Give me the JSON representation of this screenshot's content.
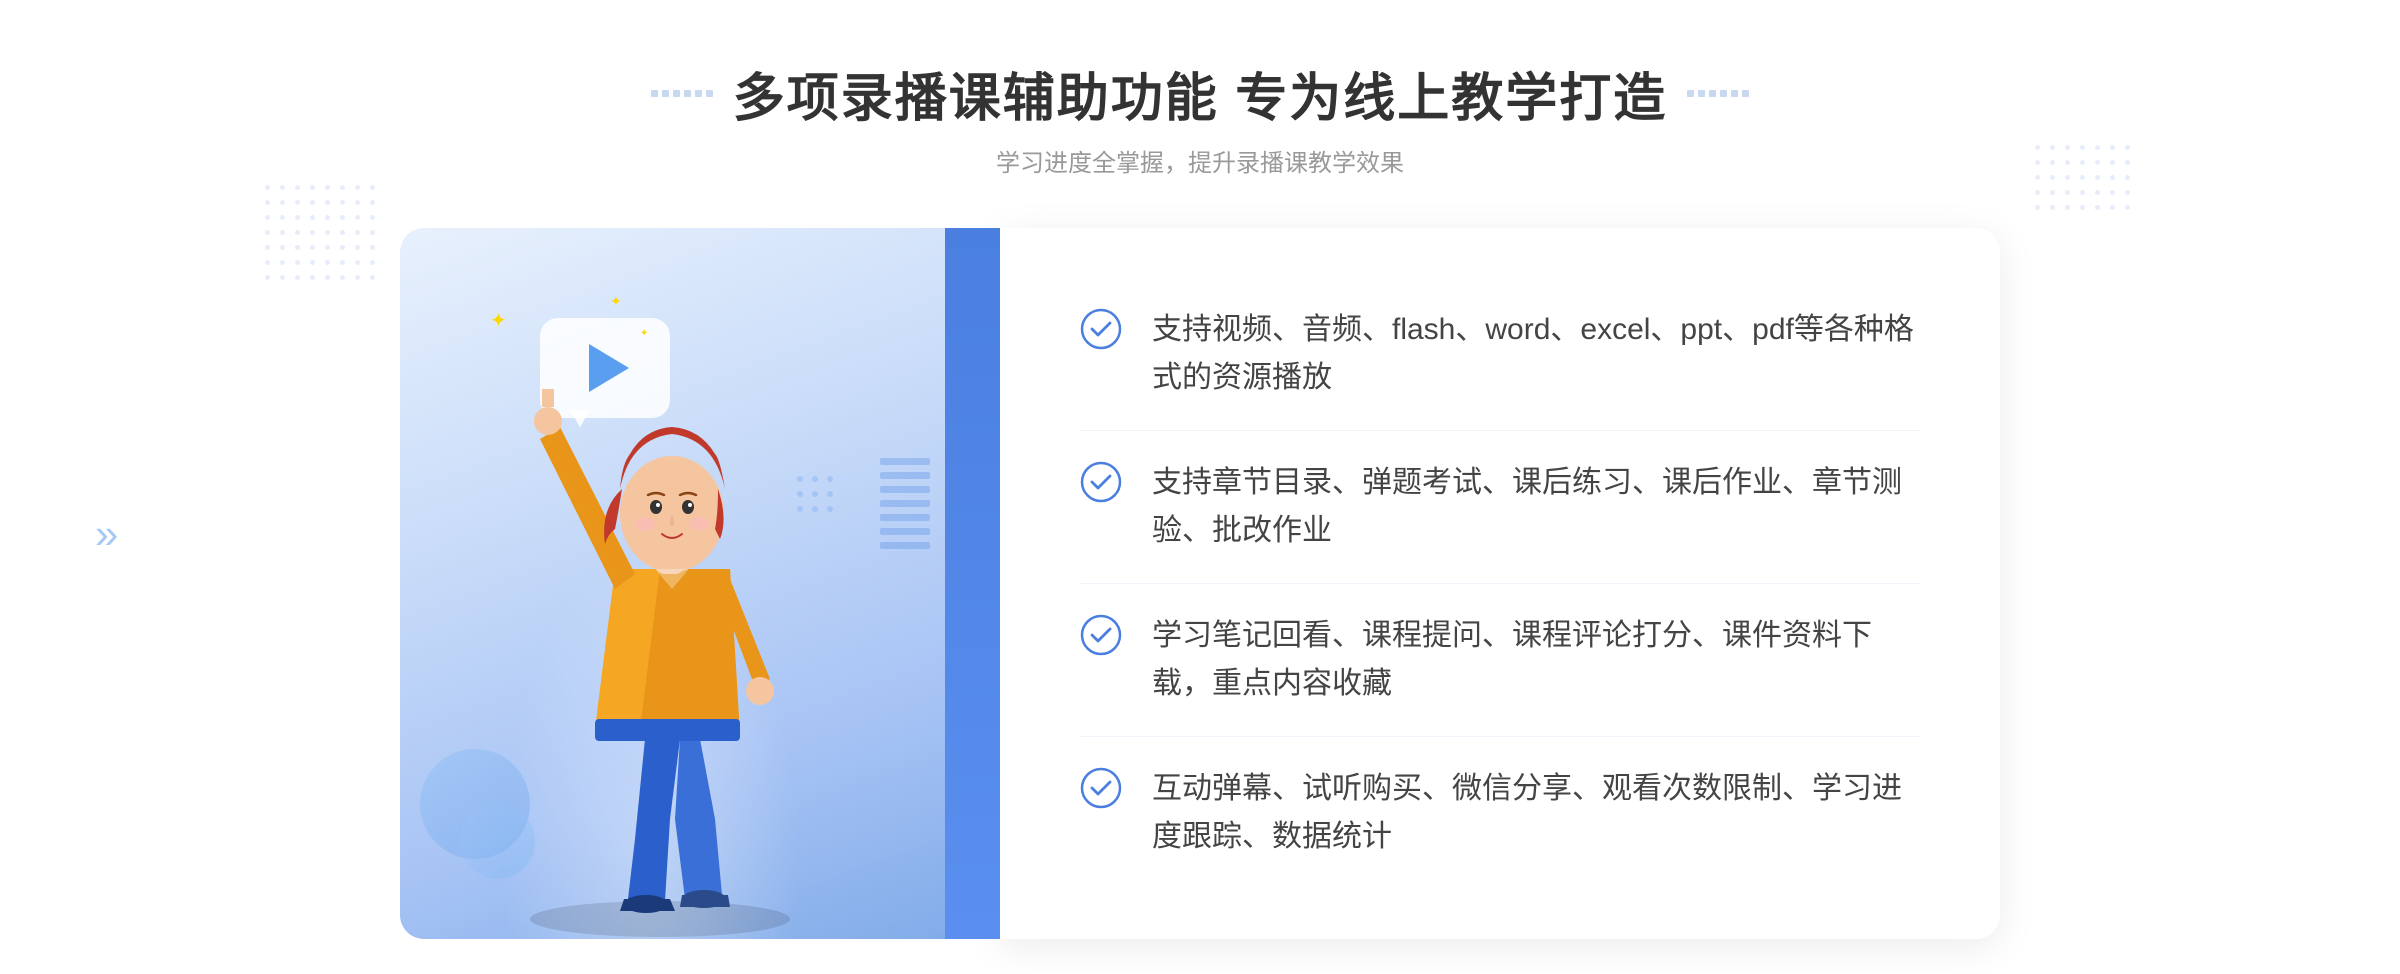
{
  "header": {
    "title": "多项录播课辅助功能 专为线上教学打造",
    "subtitle": "学习进度全掌握，提升录播课教学效果",
    "title_dots_left": "decorative-dots",
    "title_dots_right": "decorative-dots"
  },
  "features": [
    {
      "id": 1,
      "text": "支持视频、音频、flash、word、excel、ppt、pdf等各种格式的资源播放"
    },
    {
      "id": 2,
      "text": "支持章节目录、弹题考试、课后练习、课后作业、章节测验、批改作业"
    },
    {
      "id": 3,
      "text": "学习笔记回看、课程提问、课程评论打分、课件资料下载，重点内容收藏"
    },
    {
      "id": 4,
      "text": "互动弹幕、试听购买、微信分享、观看次数限制、学习进度跟踪、数据统计"
    }
  ],
  "colors": {
    "accent_blue": "#4a7fe0",
    "light_blue": "#7aaef5",
    "check_color": "#4a7fe0",
    "title_color": "#333333",
    "subtitle_color": "#999999",
    "feature_text_color": "#444444"
  },
  "icons": {
    "check_circle": "check-circle-icon",
    "play": "play-icon",
    "chevron": "chevron-icon"
  }
}
